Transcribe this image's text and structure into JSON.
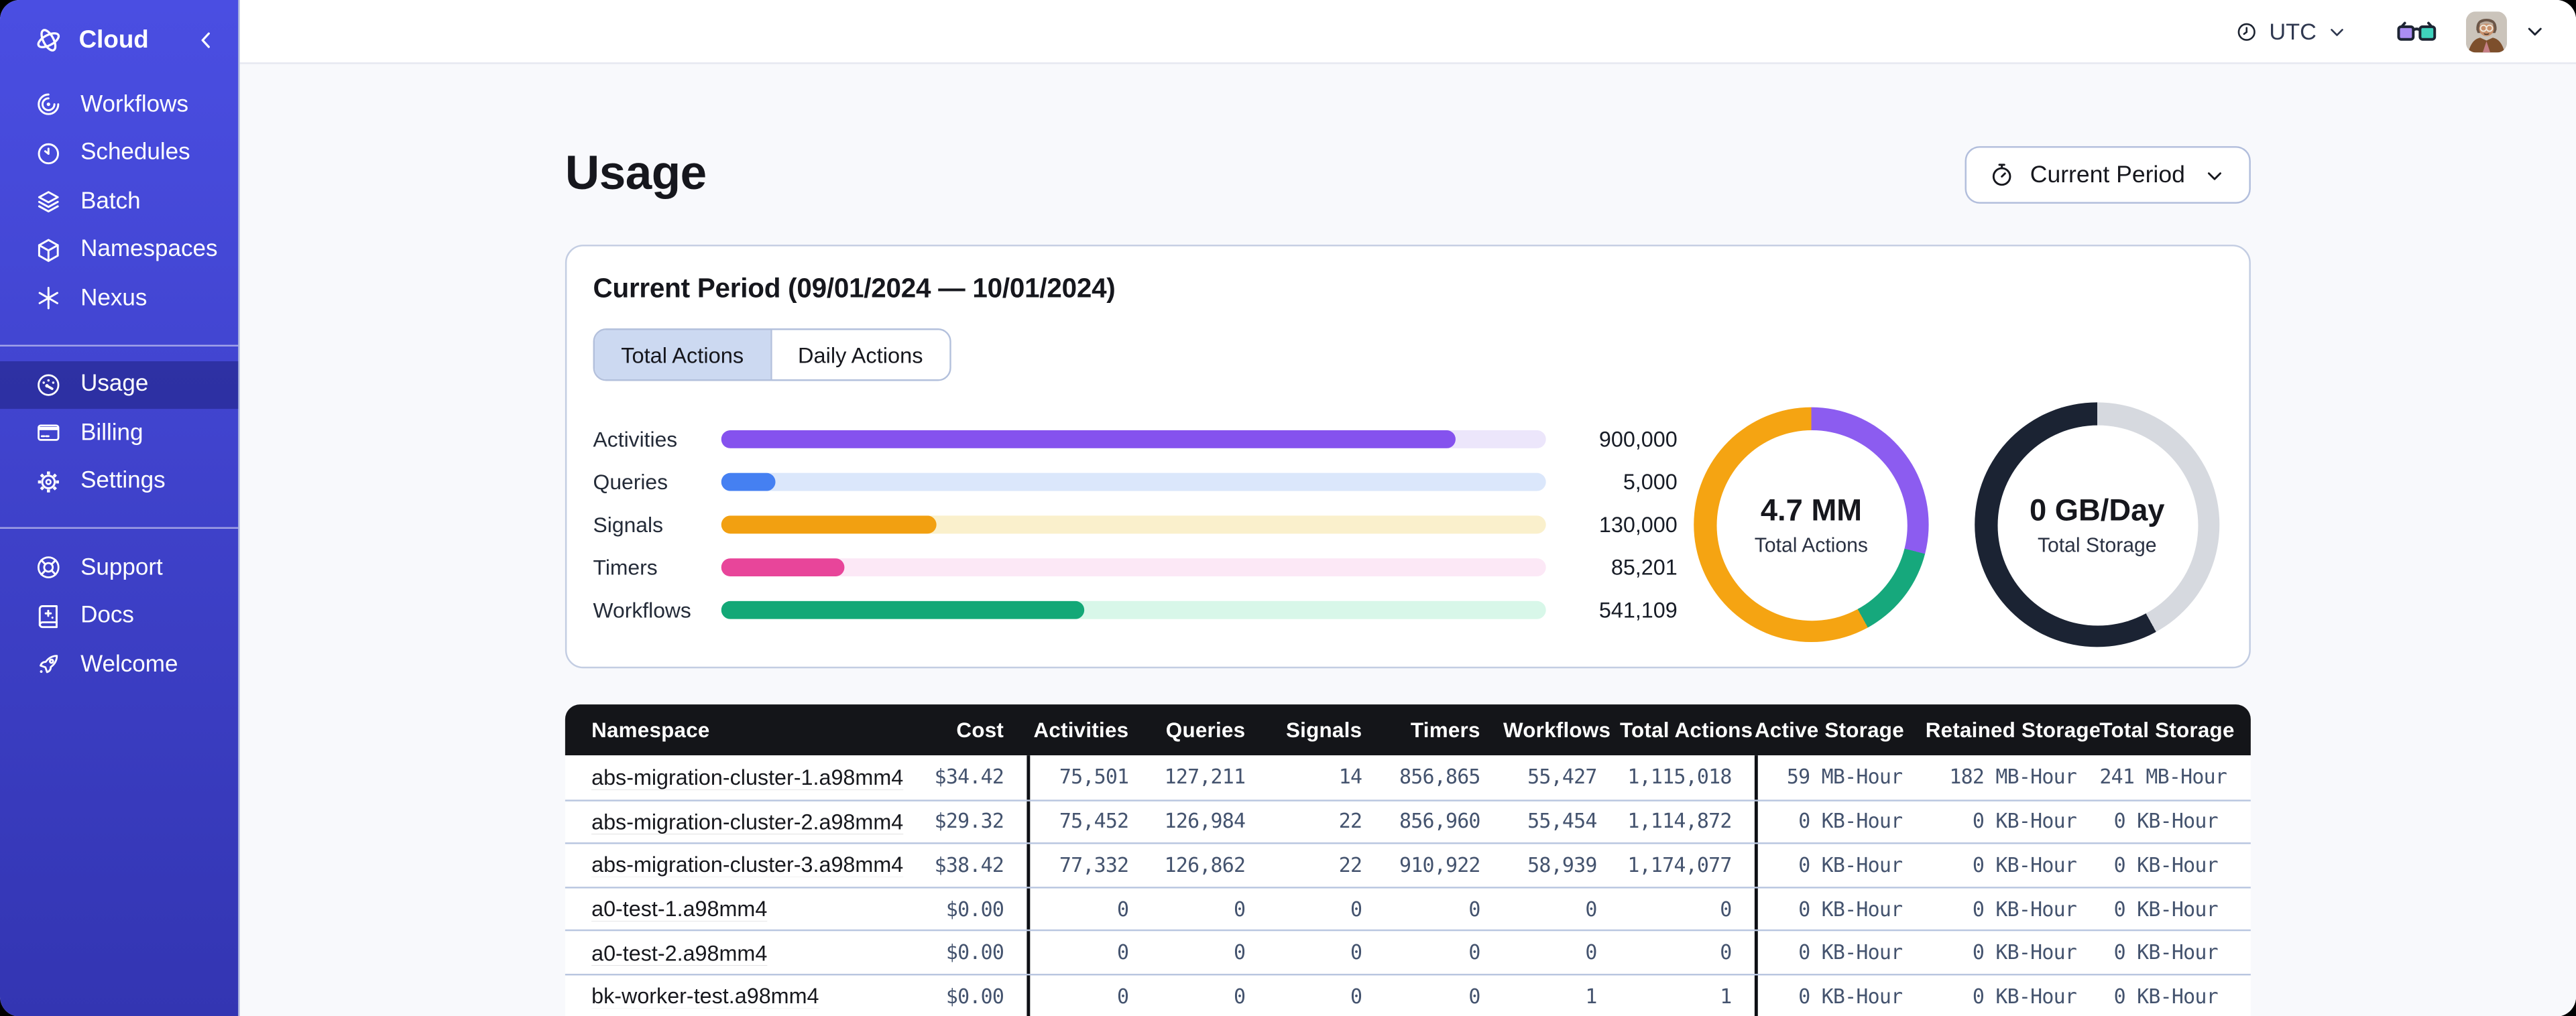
{
  "theme": {
    "sidebar_gradient_top": "#4a4ee2",
    "sidebar_gradient_bottom": "#3335b2",
    "sidebar_active_bg": "rgba(10,12,80,0.35)",
    "table_header_bg": "#141519",
    "page_bg": "#f8f9fc",
    "card_border": "#c3cde2",
    "tab_selected_bg": "#ccd9f1",
    "row_divider": "#b9c6e0",
    "number_color": "#44536e",
    "link_color": "#17181d"
  },
  "sidebar": {
    "brand": {
      "label": "Cloud",
      "icon": "temporal-logo",
      "collapse_icon": "chevron-left"
    },
    "groups": [
      {
        "items": [
          {
            "label": "Workflows",
            "icon": "workflows"
          },
          {
            "label": "Schedules",
            "icon": "schedules"
          },
          {
            "label": "Batch",
            "icon": "batch"
          },
          {
            "label": "Namespaces",
            "icon": "namespaces"
          },
          {
            "label": "Nexus",
            "icon": "nexus"
          }
        ]
      },
      {
        "items": [
          {
            "label": "Usage",
            "icon": "usage",
            "active": true
          },
          {
            "label": "Billing",
            "icon": "billing"
          },
          {
            "label": "Settings",
            "icon": "settings"
          }
        ]
      },
      {
        "items": [
          {
            "label": "Support",
            "icon": "support"
          },
          {
            "label": "Docs",
            "icon": "docs"
          },
          {
            "label": "Welcome",
            "icon": "welcome"
          }
        ]
      }
    ]
  },
  "topbar": {
    "timezone": "UTC"
  },
  "page": {
    "title": "Usage",
    "period_button": {
      "label": "Current Period",
      "icon": "stopwatch"
    }
  },
  "usage_card": {
    "title": "Current Period (09/01/2024 — 10/01/2024)",
    "tabs": [
      {
        "label": "Total Actions",
        "selected": true
      },
      {
        "label": "Daily Actions",
        "selected": false
      }
    ]
  },
  "chart_data": [
    {
      "type": "bar",
      "orientation": "horizontal",
      "categories": [
        "Activities",
        "Queries",
        "Signals",
        "Timers",
        "Workflows"
      ],
      "values": [
        900000,
        5000,
        130000,
        85201,
        541109
      ],
      "display_values": [
        "900,000",
        "5,000",
        "130,000",
        "85,201",
        "541,109"
      ],
      "fill_pct": [
        89,
        6.5,
        26,
        15,
        44
      ],
      "colors": [
        {
          "fill": "#8552ee",
          "track": "#ece6fb"
        },
        {
          "fill": "#4580f2",
          "track": "#dbe7fb"
        },
        {
          "fill": "#f2a011",
          "track": "#faf0cc"
        },
        {
          "fill": "#e8459a",
          "track": "#fce8f6"
        },
        {
          "fill": "#13a877",
          "track": "#d8f7e9"
        }
      ],
      "grid": false,
      "legend": false
    },
    {
      "type": "pie",
      "subtype": "donut",
      "center_label": "4.7 MM",
      "center_sublabel": "Total Actions",
      "segments": [
        {
          "name": "purple",
          "color": "#8c5cf0",
          "pct": 29
        },
        {
          "name": "green",
          "color": "#16a87c",
          "pct": 13
        },
        {
          "name": "orange",
          "color": "#f5a412",
          "pct": 58
        }
      ]
    },
    {
      "type": "pie",
      "subtype": "donut",
      "center_label": "0 GB/Day",
      "center_sublabel": "Total Storage",
      "segments": [
        {
          "name": "gray",
          "color": "#d6d9df",
          "pct": 42
        },
        {
          "name": "dark",
          "color": "#1b2333",
          "pct": 58
        }
      ]
    }
  ],
  "table": {
    "columns": [
      "Namespace",
      "Cost",
      "Activities",
      "Queries",
      "Signals",
      "Timers",
      "Workflows",
      "Total Actions",
      "Active Storage",
      "Retained Storage",
      "Total Storage"
    ],
    "rows": [
      [
        "abs-migration-cluster-1.a98mm4",
        "$34.42",
        "75,501",
        "127,211",
        "14",
        "856,865",
        "55,427",
        "1,115,018",
        "59 MB-Hour",
        "182 MB-Hour",
        "241 MB-Hour"
      ],
      [
        "abs-migration-cluster-2.a98mm4",
        "$29.32",
        "75,452",
        "126,984",
        "22",
        "856,960",
        "55,454",
        "1,114,872",
        "0 KB-Hour",
        "0 KB-Hour",
        "0 KB-Hour"
      ],
      [
        "abs-migration-cluster-3.a98mm4",
        "$38.42",
        "77,332",
        "126,862",
        "22",
        "910,922",
        "58,939",
        "1,174,077",
        "0 KB-Hour",
        "0 KB-Hour",
        "0 KB-Hour"
      ],
      [
        "a0-test-1.a98mm4",
        "$0.00",
        "0",
        "0",
        "0",
        "0",
        "0",
        "0",
        "0 KB-Hour",
        "0 KB-Hour",
        "0 KB-Hour"
      ],
      [
        "a0-test-2.a98mm4",
        "$0.00",
        "0",
        "0",
        "0",
        "0",
        "0",
        "0",
        "0 KB-Hour",
        "0 KB-Hour",
        "0 KB-Hour"
      ],
      [
        "bk-worker-test.a98mm4",
        "$0.00",
        "0",
        "0",
        "0",
        "0",
        "1",
        "1",
        "0 KB-Hour",
        "0 KB-Hour",
        "0 KB-Hour"
      ]
    ]
  }
}
